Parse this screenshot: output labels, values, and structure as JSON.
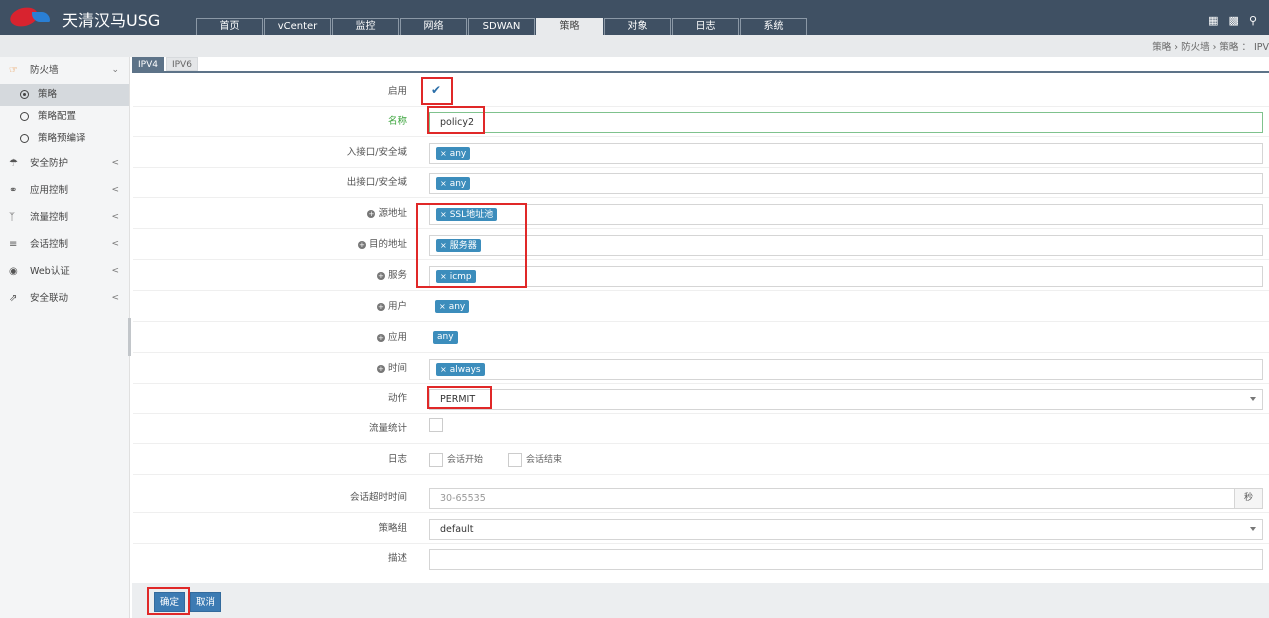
{
  "app": {
    "title": "天清汉马USG",
    "logo_text": "天清"
  },
  "nav": {
    "tabs": [
      "首页",
      "vCenter",
      "监控",
      "网络",
      "SDWAN",
      "策略",
      "对象",
      "日志",
      "系统"
    ],
    "active": "策略"
  },
  "breadcrumb": {
    "text": "策略 › 防火墙 › 策略 ： IPV"
  },
  "sidebar": {
    "firewall": "防火墙",
    "sub_items": [
      "策略",
      "策略配置",
      "策略预编译"
    ],
    "items": [
      "安全防护",
      "应用控制",
      "流量控制",
      "会话控制",
      "Web认证",
      "安全联动"
    ]
  },
  "ip_tabs": [
    "IPV4",
    "IPV6"
  ],
  "form": {
    "enable_label": "启用",
    "name_label": "名称",
    "name_value": "policy2",
    "in_label": "入接口/安全域",
    "in_tag": "any",
    "out_label": "出接口/安全域",
    "out_tag": "any",
    "src_label": "源地址",
    "src_tag": "SSL地址池",
    "dst_label": "目的地址",
    "dst_tag": "服务器",
    "svc_label": "服务",
    "svc_tag": "icmp",
    "user_label": "用户",
    "user_tag": "any",
    "app_label": "应用",
    "app_tag": "any",
    "time_label": "时间",
    "time_tag": "always",
    "action_label": "动作",
    "action_value": "PERMIT",
    "traffic_label": "流量统计",
    "log_label": "日志",
    "log_start": "会话开始",
    "log_end": "会话结束",
    "timeout_label": "会话超时时间",
    "timeout_placeholder": "30-65535",
    "timeout_unit": "秒",
    "group_label": "策略组",
    "group_value": "default",
    "desc_label": "描述"
  },
  "buttons": {
    "ok": "确定",
    "cancel": "取消"
  },
  "colors": {
    "topbar": "#3f5063",
    "tag": "#3c8dbc",
    "annotation": "#e02828"
  }
}
